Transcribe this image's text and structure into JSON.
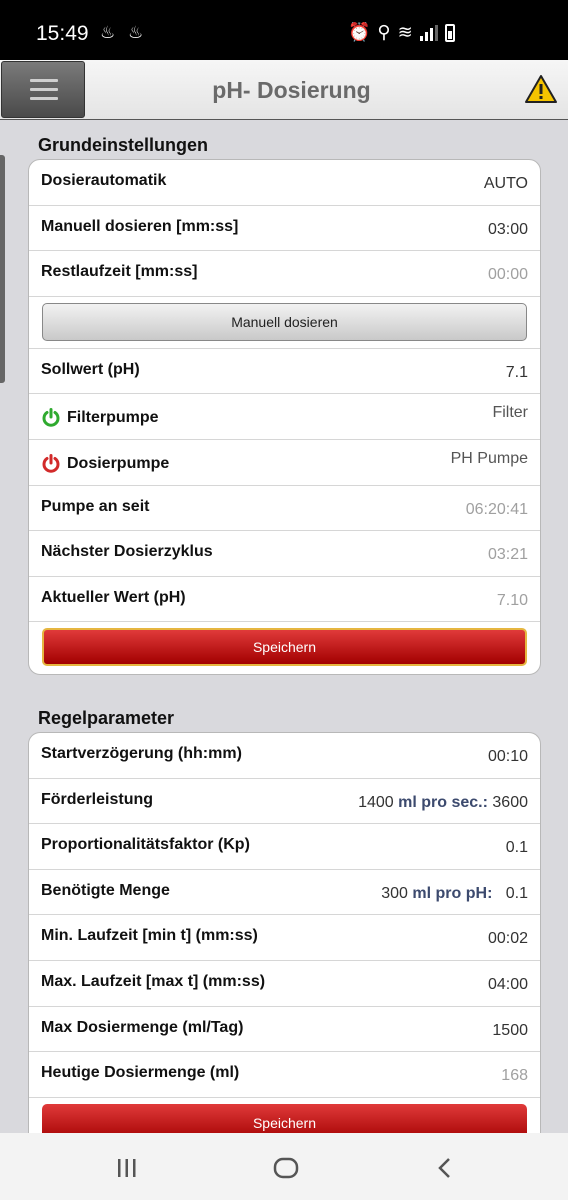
{
  "status": {
    "time": "15:49",
    "notifications": "♨♨",
    "battery": "battery-icon"
  },
  "header": {
    "title": "pH- Dosierung",
    "menu_icon": "hamburger-menu-icon",
    "warning_icon": "warning-icon"
  },
  "grund": {
    "title": "Grundeinstellungen",
    "rows": [
      {
        "label": "Dosierautomatik",
        "value": "AUTO"
      },
      {
        "label": "Manuell dosieren [mm:ss]",
        "value": "03:00"
      },
      {
        "label": "Restlaufzeit [mm:ss]",
        "value": "00:00"
      }
    ],
    "manual_button": "Manuell dosieren",
    "rows2": [
      {
        "label": "Sollwert (pH)",
        "value": "7.1"
      },
      {
        "label": "Filterpumpe",
        "value": "Filter",
        "icon": "power-on-icon",
        "icon_color": "#2faa2f"
      },
      {
        "label": "Dosierpumpe",
        "value": "PH Pumpe",
        "icon": "power-off-icon",
        "icon_color": "#d22a2a"
      },
      {
        "label": "Pumpe an seit",
        "value": "06:20:41"
      },
      {
        "label": "Nächster Dosierzyklus",
        "value": "03:21"
      },
      {
        "label": "Aktueller Wert (pH)",
        "value": "7.10"
      }
    ],
    "save_button": "Speichern"
  },
  "regel": {
    "title": "Regelparameter",
    "rows": [
      {
        "label": "Startverzögerung (hh:mm)",
        "value": "00:10"
      },
      {
        "label": "Förderleistung",
        "value_a": "1400",
        "unit": "ml pro sec.:",
        "value_b": "3600"
      },
      {
        "label": "Proportionalitätsfaktor (Kp)",
        "value": "0.1"
      },
      {
        "label": "Benötigte Menge",
        "value_a": "300",
        "unit": "ml pro pH:",
        "value_b": "0.1"
      },
      {
        "label": "Min. Laufzeit [min t] (mm:ss)",
        "value": "00:02"
      },
      {
        "label": "Max. Laufzeit [max t] (mm:ss)",
        "value": "04:00"
      },
      {
        "label": "Max Dosiermenge (ml/Tag)",
        "value": "1500"
      },
      {
        "label": "Heutige Dosiermenge (ml)",
        "value": "168"
      }
    ],
    "save_button": "Speichern"
  },
  "colors": {
    "accent_red": "#c41414",
    "power_on": "#2faa2f",
    "power_off": "#d22a2a"
  }
}
